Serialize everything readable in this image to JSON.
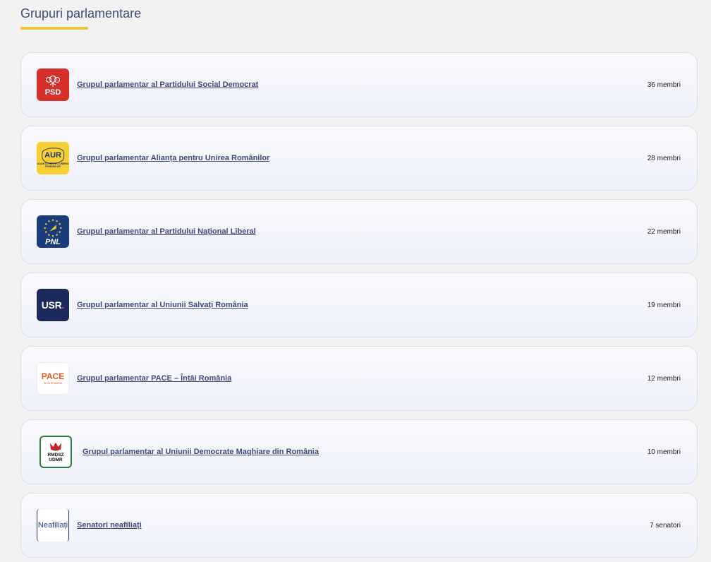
{
  "page": {
    "title": "Grupuri parlamentare",
    "accent_color": "#ebc23c",
    "title_color": "#3f4a7c"
  },
  "groups": [
    {
      "logo_text": "PSD",
      "logo_icon": "rose-icon",
      "logo_color": "#d7302b",
      "name": "Grupul parlamentar al Partidului Social Democrat",
      "count": "36 membri"
    },
    {
      "logo_text": "AUR",
      "logo_subtext": "ALIANȚA PENTRU UNIREA ROMÂNILOR",
      "logo_color": "#f6cf32",
      "name": "Grupul parlamentar Alianța pentru Unirea Românilor",
      "count": "28 membri"
    },
    {
      "logo_text": "PNL",
      "logo_icon": "eu-stars-icon",
      "logo_color": "#1b3c7a",
      "name": "Grupul parlamentar al Partidului Național Liberal",
      "count": "22 membri"
    },
    {
      "logo_text": "USR",
      "logo_color": "#1b2a5b",
      "name": "Grupul parlamentar al Uniunii Salvați România",
      "count": "19 membri"
    },
    {
      "logo_text": "PACE",
      "logo_subtext": "ÎNTÂI ROMÂNIA",
      "logo_color": "#e85a23",
      "name": "Grupul parlamentar PACE – Întâi România",
      "count": "12 membri"
    },
    {
      "logo_text": "RMDSZ UDMR",
      "logo_icon": "tulip-icon",
      "logo_color": "#c8202b",
      "name": "Grupul parlamentar al Uniunii Democrate Maghiare din România",
      "count": "10 membri"
    },
    {
      "logo_text": "Neafiliați",
      "logo_color": "#27408b",
      "name": "Senatori neafiliați",
      "count": "7 senatori"
    }
  ]
}
